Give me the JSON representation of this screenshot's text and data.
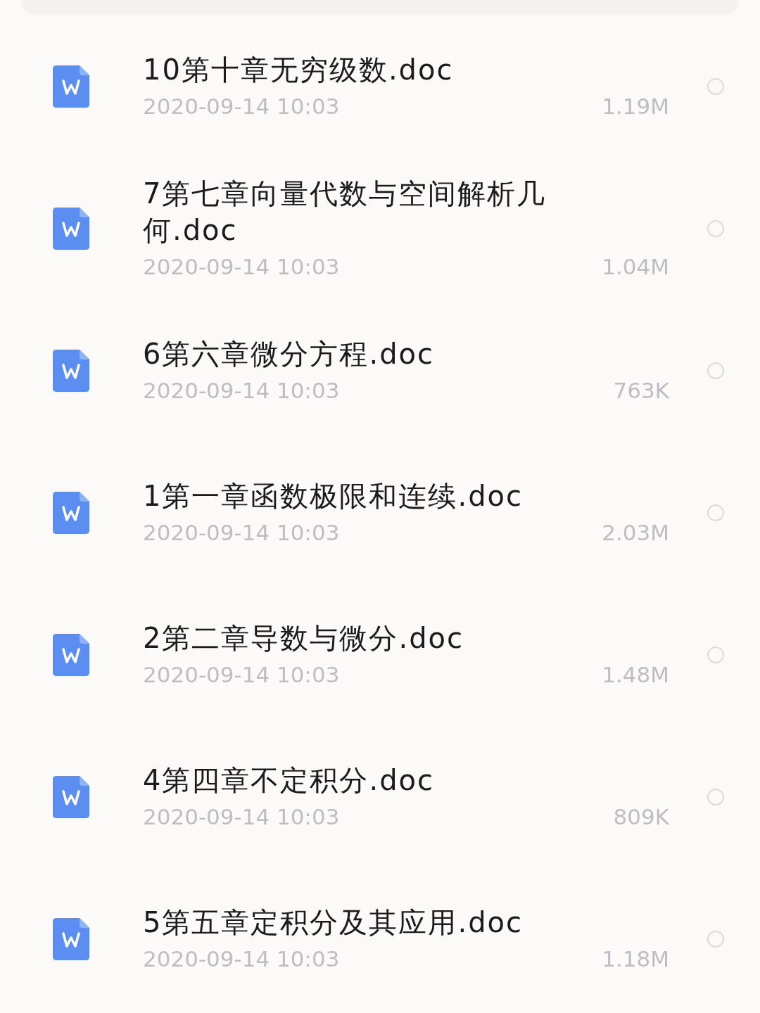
{
  "files": [
    {
      "title": "10第十章无穷级数.doc",
      "date": "2020-09-14 10:03",
      "size": "1.19M",
      "selected": false
    },
    {
      "title": "7第七章向量代数与空间解析几何.doc",
      "date": "2020-09-14 10:03",
      "size": "1.04M",
      "selected": false
    },
    {
      "title": "6第六章微分方程.doc",
      "date": "2020-09-14 10:03",
      "size": "763K",
      "selected": false
    },
    {
      "title": "1第一章函数极限和连续.doc",
      "date": "2020-09-14 10:03",
      "size": "2.03M",
      "selected": false
    },
    {
      "title": "2第二章导数与微分.doc",
      "date": "2020-09-14 10:03",
      "size": "1.48M",
      "selected": false
    },
    {
      "title": "4第四章不定积分.doc",
      "date": "2020-09-14 10:03",
      "size": "809K",
      "selected": false
    },
    {
      "title": "5第五章定积分及其应用.doc",
      "date": "2020-09-14 10:03",
      "size": "1.18M",
      "selected": false
    }
  ]
}
